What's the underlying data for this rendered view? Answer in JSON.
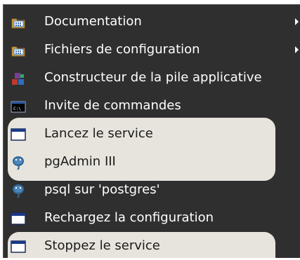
{
  "menu": {
    "items": [
      {
        "label": "Documentation",
        "icon": "folder-icon",
        "has_submenu": true
      },
      {
        "label": "Fichiers de configuration",
        "icon": "folder-icon",
        "has_submenu": true
      },
      {
        "label": "Constructeur de la pile applicative",
        "icon": "stack-builder-icon",
        "has_submenu": false
      },
      {
        "label": "Invite de commandes",
        "icon": "command-prompt-icon",
        "has_submenu": false
      },
      {
        "label": "Lancez le service",
        "icon": "window-icon",
        "has_submenu": false,
        "highlighted": true
      },
      {
        "label": "pgAdmin III",
        "icon": "postgres-elephant-icon",
        "has_submenu": false,
        "highlighted": true
      },
      {
        "label": "psql sur 'postgres'",
        "icon": "postgres-elephant-icon",
        "has_submenu": false
      },
      {
        "label": "Rechargez la configuration",
        "icon": "window-icon",
        "has_submenu": false
      },
      {
        "label": "Stoppez le service",
        "icon": "window-icon",
        "has_submenu": false,
        "highlighted": true
      }
    ]
  },
  "colors": {
    "menu_background": "#2f2f2f",
    "highlight": "#e7e4dd",
    "text_light": "#ffffff",
    "text_dark": "#1a1a1a"
  }
}
